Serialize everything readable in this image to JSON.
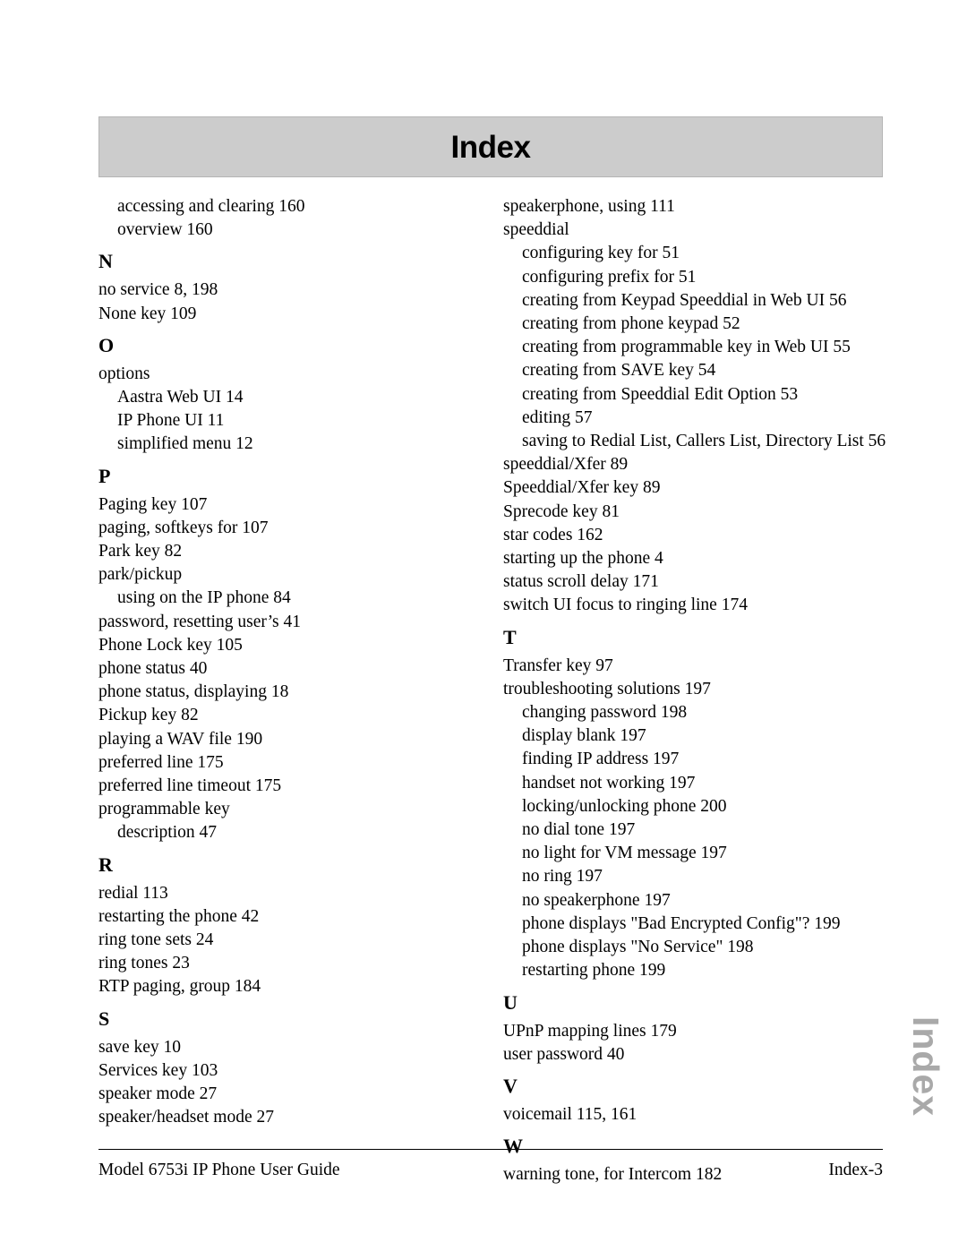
{
  "header": {
    "title": "Index"
  },
  "side_tab": {
    "label": "Index",
    "color": "#a9a9a9"
  },
  "footer": {
    "guide_title": "Model 6753i IP Phone User Guide",
    "page_number": "Index-3"
  },
  "colors": {
    "banner_background": "#cccccc",
    "banner_border": "#b5b5b5",
    "text": "#000000",
    "side_tab": "#a9a9a9"
  },
  "index": {
    "left_column": [
      {
        "type": "entry",
        "level": 2,
        "text": "accessing and clearing 160"
      },
      {
        "type": "entry",
        "level": 2,
        "text": "overview 160"
      },
      {
        "type": "letter",
        "text": "N"
      },
      {
        "type": "entry",
        "level": 1,
        "text": "no service 8, 198"
      },
      {
        "type": "entry",
        "level": 1,
        "text": "None key 109"
      },
      {
        "type": "letter",
        "text": "O"
      },
      {
        "type": "entry",
        "level": 1,
        "text": "options"
      },
      {
        "type": "entry",
        "level": 2,
        "text": "Aastra Web UI 14"
      },
      {
        "type": "entry",
        "level": 2,
        "text": "IP Phone UI 11"
      },
      {
        "type": "entry",
        "level": 2,
        "text": "simplified menu 12"
      },
      {
        "type": "letter",
        "text": "P"
      },
      {
        "type": "entry",
        "level": 1,
        "text": "Paging key 107"
      },
      {
        "type": "entry",
        "level": 1,
        "text": "paging, softkeys for 107"
      },
      {
        "type": "entry",
        "level": 1,
        "text": "Park key 82"
      },
      {
        "type": "entry",
        "level": 1,
        "text": "park/pickup"
      },
      {
        "type": "entry",
        "level": 2,
        "text": "using on the IP phone 84"
      },
      {
        "type": "entry",
        "level": 1,
        "text": "password, resetting user’s 41"
      },
      {
        "type": "entry",
        "level": 1,
        "text": "Phone Lock key 105"
      },
      {
        "type": "entry",
        "level": 1,
        "text": "phone status 40"
      },
      {
        "type": "entry",
        "level": 1,
        "text": "phone status, displaying 18"
      },
      {
        "type": "entry",
        "level": 1,
        "text": "Pickup key 82"
      },
      {
        "type": "entry",
        "level": 1,
        "text": "playing a WAV file 190"
      },
      {
        "type": "entry",
        "level": 1,
        "text": "preferred line 175"
      },
      {
        "type": "entry",
        "level": 1,
        "text": "preferred line timeout 175"
      },
      {
        "type": "entry",
        "level": 1,
        "text": "programmable key"
      },
      {
        "type": "entry",
        "level": 2,
        "text": "description 47"
      },
      {
        "type": "letter",
        "text": "R"
      },
      {
        "type": "entry",
        "level": 1,
        "text": "redial 113"
      },
      {
        "type": "entry",
        "level": 1,
        "text": "restarting the phone 42"
      },
      {
        "type": "entry",
        "level": 1,
        "text": "ring tone sets 24"
      },
      {
        "type": "entry",
        "level": 1,
        "text": "ring tones 23"
      },
      {
        "type": "entry",
        "level": 1,
        "text": "RTP paging, group 184"
      },
      {
        "type": "letter",
        "text": "S"
      },
      {
        "type": "entry",
        "level": 1,
        "text": "save key 10"
      },
      {
        "type": "entry",
        "level": 1,
        "text": "Services key 103"
      },
      {
        "type": "entry",
        "level": 1,
        "text": "speaker mode 27"
      },
      {
        "type": "entry",
        "level": 1,
        "text": "speaker/headset mode 27"
      }
    ],
    "right_column": [
      {
        "type": "entry",
        "level": 1,
        "text": "speakerphone, using 111"
      },
      {
        "type": "entry",
        "level": 1,
        "text": "speeddial"
      },
      {
        "type": "entry",
        "level": 2,
        "text": "configuring key for 51"
      },
      {
        "type": "entry",
        "level": 2,
        "text": "configuring prefix for 51"
      },
      {
        "type": "entry",
        "level": 2,
        "text": "creating from Keypad Speeddial in Web UI 56"
      },
      {
        "type": "entry",
        "level": 2,
        "text": "creating from phone keypad 52"
      },
      {
        "type": "entry",
        "level": 2,
        "text": "creating from programmable key in Web UI 55"
      },
      {
        "type": "entry",
        "level": 2,
        "text": "creating from SAVE key 54"
      },
      {
        "type": "entry",
        "level": 2,
        "text": "creating from Speeddial Edit Option 53"
      },
      {
        "type": "entry",
        "level": 2,
        "text": "editing 57"
      },
      {
        "type": "entry",
        "level": 2,
        "text": "saving to Redial List, Callers List, Directory List 56"
      },
      {
        "type": "entry",
        "level": 1,
        "text": "speeddial/Xfer 89"
      },
      {
        "type": "entry",
        "level": 1,
        "text": "Speeddial/Xfer key 89"
      },
      {
        "type": "entry",
        "level": 1,
        "text": "Sprecode key 81"
      },
      {
        "type": "entry",
        "level": 1,
        "text": "star codes 162"
      },
      {
        "type": "entry",
        "level": 1,
        "text": "starting up the phone 4"
      },
      {
        "type": "entry",
        "level": 1,
        "text": "status scroll delay 171"
      },
      {
        "type": "entry",
        "level": 1,
        "text": "switch UI focus to ringing line 174"
      },
      {
        "type": "letter",
        "text": "T"
      },
      {
        "type": "entry",
        "level": 1,
        "text": "Transfer key 97"
      },
      {
        "type": "entry",
        "level": 1,
        "text": "troubleshooting solutions 197"
      },
      {
        "type": "entry",
        "level": 2,
        "text": "changing password 198"
      },
      {
        "type": "entry",
        "level": 2,
        "text": "display blank 197"
      },
      {
        "type": "entry",
        "level": 2,
        "text": "finding IP address 197"
      },
      {
        "type": "entry",
        "level": 2,
        "text": "handset not working 197"
      },
      {
        "type": "entry",
        "level": 2,
        "text": "locking/unlocking phone 200"
      },
      {
        "type": "entry",
        "level": 2,
        "text": "no dial tone 197"
      },
      {
        "type": "entry",
        "level": 2,
        "text": "no light for VM message 197"
      },
      {
        "type": "entry",
        "level": 2,
        "text": "no ring 197"
      },
      {
        "type": "entry",
        "level": 2,
        "text": "no speakerphone 197"
      },
      {
        "type": "entry",
        "level": 2,
        "text": "phone displays \"Bad Encrypted Config\"? 199"
      },
      {
        "type": "entry",
        "level": 2,
        "text": "phone displays \"No Service\" 198"
      },
      {
        "type": "entry",
        "level": 2,
        "text": "restarting phone 199"
      },
      {
        "type": "letter",
        "text": "U"
      },
      {
        "type": "entry",
        "level": 1,
        "text": "UPnP mapping lines 179"
      },
      {
        "type": "entry",
        "level": 1,
        "text": "user password 40"
      },
      {
        "type": "letter",
        "text": "V"
      },
      {
        "type": "entry",
        "level": 1,
        "text": "voicemail 115, 161"
      },
      {
        "type": "letter",
        "text": "W"
      },
      {
        "type": "entry",
        "level": 1,
        "text": "warning tone, for Intercom 182"
      }
    ]
  }
}
